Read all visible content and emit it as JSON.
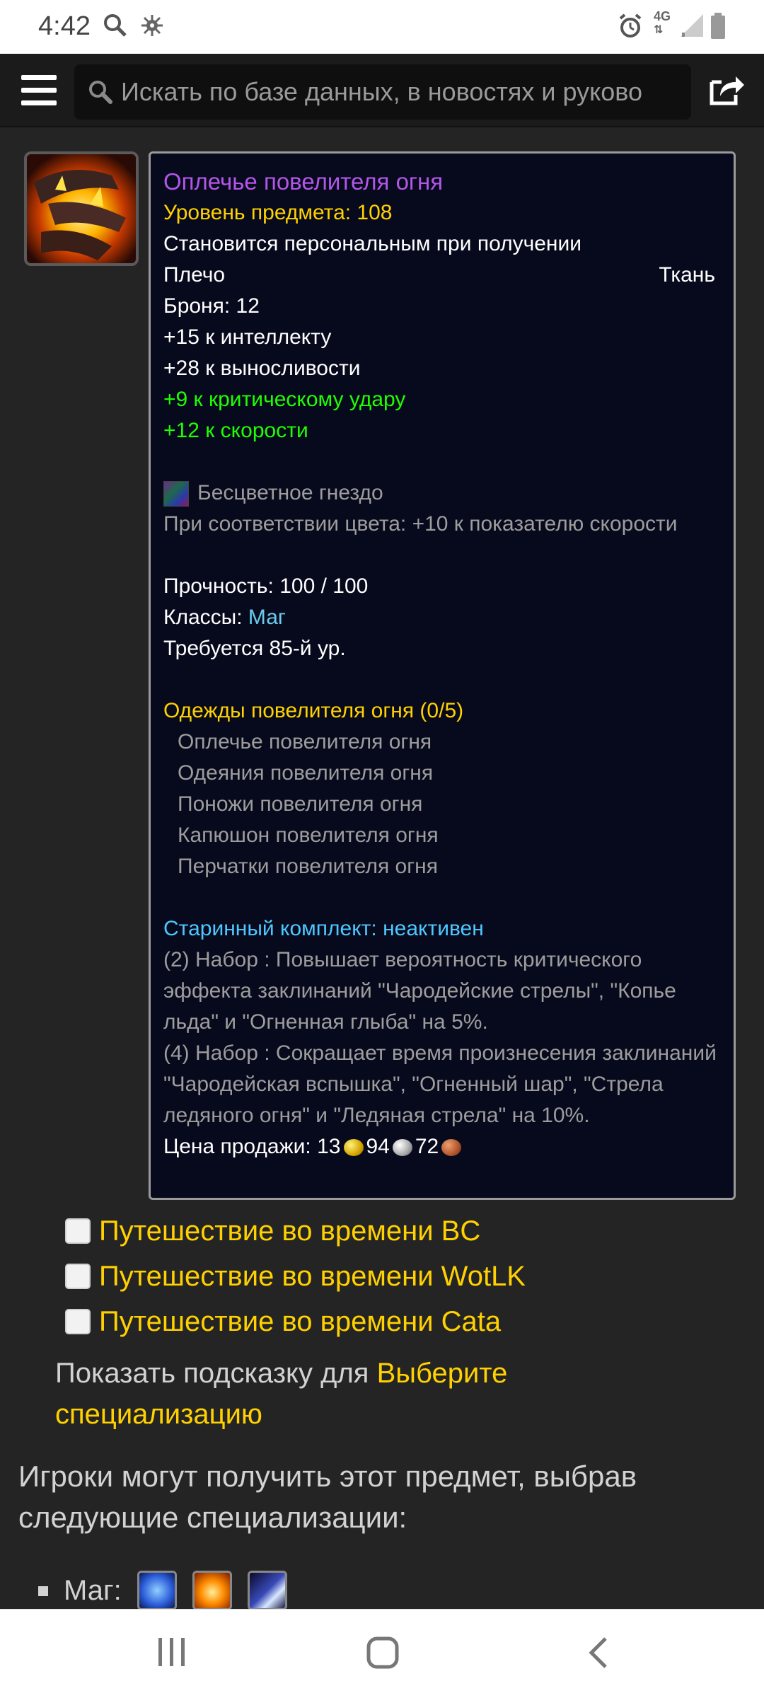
{
  "status": {
    "time": "4:42",
    "network": "4G"
  },
  "search": {
    "placeholder": "Искать по базе данных, в новостях и руково"
  },
  "item": {
    "icon": "fire-shoulder-icon",
    "title": "Оплечье повелителя огня",
    "item_level": "Уровень предмета: 108",
    "binding": "Становится персональным при получении",
    "slot": "Плечо",
    "armor_type": "Ткань",
    "armor": "Броня: 12",
    "stat_int": "+15 к интеллекту",
    "stat_sta": "+28 к выносливости",
    "stat_crit": "+9 к критическому удару",
    "stat_haste": "+12 к скорости",
    "socket": "Бесцветное гнездо",
    "socket_bonus": "При соответствии цвета: +10 к показателю скорости",
    "durability": "Прочность: 100 / 100",
    "classes_label": "Классы:",
    "classes_value": "Маг",
    "required_level": "Требуется 85-й ур.",
    "set_name": "Одежды повелителя огня (0/5)",
    "set_items": [
      "Оплечье повелителя огня",
      "Одеяния повелителя огня",
      "Поножи повелителя огня",
      "Капюшон повелителя огня",
      "Перчатки повелителя огня"
    ],
    "legacy_set": "Старинный комплект: неактивен",
    "bonus_2": "(2) Набор : Повышает вероятность критического эффекта заклинаний \"Чародейские стрелы\", \"Копье льда\" и \"Огненная глыба\" на 5%.",
    "bonus_4": "(4) Набор : Сокращает время произнесения заклинаний \"Чародейская вспышка\", \"Огненный шар\", \"Стрела ледяного огня\" и \"Ледяная стрела\" на 10%.",
    "sell_label": "Цена продажи:",
    "sell_gold": "13",
    "sell_silver": "94",
    "sell_copper": "72"
  },
  "filters": [
    "Путешествие во времени BC",
    "Путешествие во времени WotLK",
    "Путешествие во времени Cata"
  ],
  "hint": {
    "prefix": "Показать подсказку для",
    "link": "Выберите специализацию"
  },
  "players_text": "Игроки могут получить этот предмет, выбрав следующие специализации:",
  "spec": {
    "class": "Маг:",
    "icons": [
      "arcane-spec-icon",
      "fire-spec-icon",
      "frost-spec-icon"
    ]
  }
}
